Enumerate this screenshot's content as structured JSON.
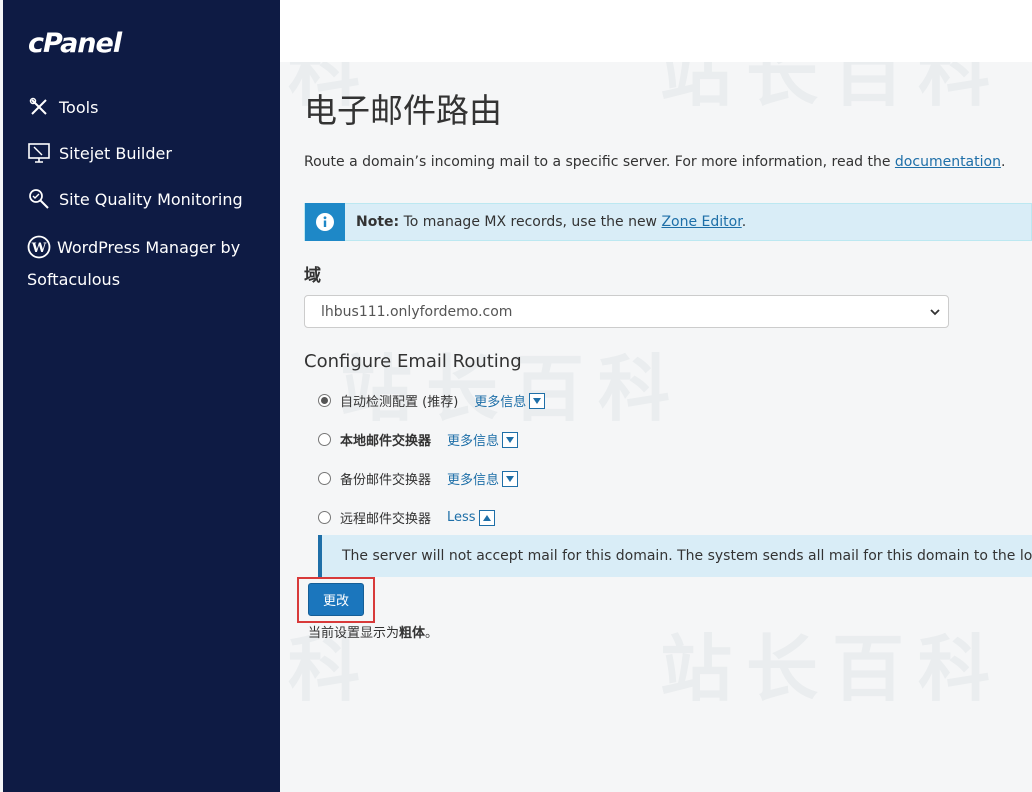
{
  "sidebar": {
    "logo": "cPanel",
    "items": [
      {
        "label": "Tools",
        "icon": "tools-icon"
      },
      {
        "label": "Sitejet Builder",
        "icon": "monitor-icon"
      },
      {
        "label": "Site Quality Monitoring",
        "icon": "magnifier-icon"
      },
      {
        "label": "WordPress Manager by Softaculous",
        "icon": "wordpress-icon"
      }
    ]
  },
  "page": {
    "title": "电子邮件路由",
    "description_prefix": "Route a domain’s incoming mail to a specific server. For more information, read the ",
    "documentation_link": "documentation",
    "description_suffix": "."
  },
  "note": {
    "label": "Note:",
    "text": " To manage MX records, use the new ",
    "link": "Zone Editor",
    "suffix": "."
  },
  "domain": {
    "label": "域",
    "selected": "lhbus111.onlyfordemo.com"
  },
  "routing": {
    "heading": "Configure Email Routing",
    "options": [
      {
        "label": "自动检测配置 (推荐)",
        "more": "更多信息",
        "checked": true
      },
      {
        "label": "本地邮件交换器",
        "more": "更多信息",
        "checked": false
      },
      {
        "label": "备份邮件交换器",
        "more": "更多信息",
        "checked": false
      },
      {
        "label": "远程邮件交换器",
        "more": "Less",
        "checked": false
      }
    ],
    "info_text": "The server will not accept mail for this domain. The system sends all mail for this domain to the lowest number..."
  },
  "actions": {
    "change_label": "更改",
    "footnote_prefix": "当前设置显示为",
    "footnote_bold": "粗体",
    "footnote_suffix": "。"
  },
  "colors": {
    "sidebar_bg": "#0e1b44",
    "accent": "#1b76bd",
    "info_bg": "#d9edf7",
    "highlight": "#d83a3a"
  }
}
